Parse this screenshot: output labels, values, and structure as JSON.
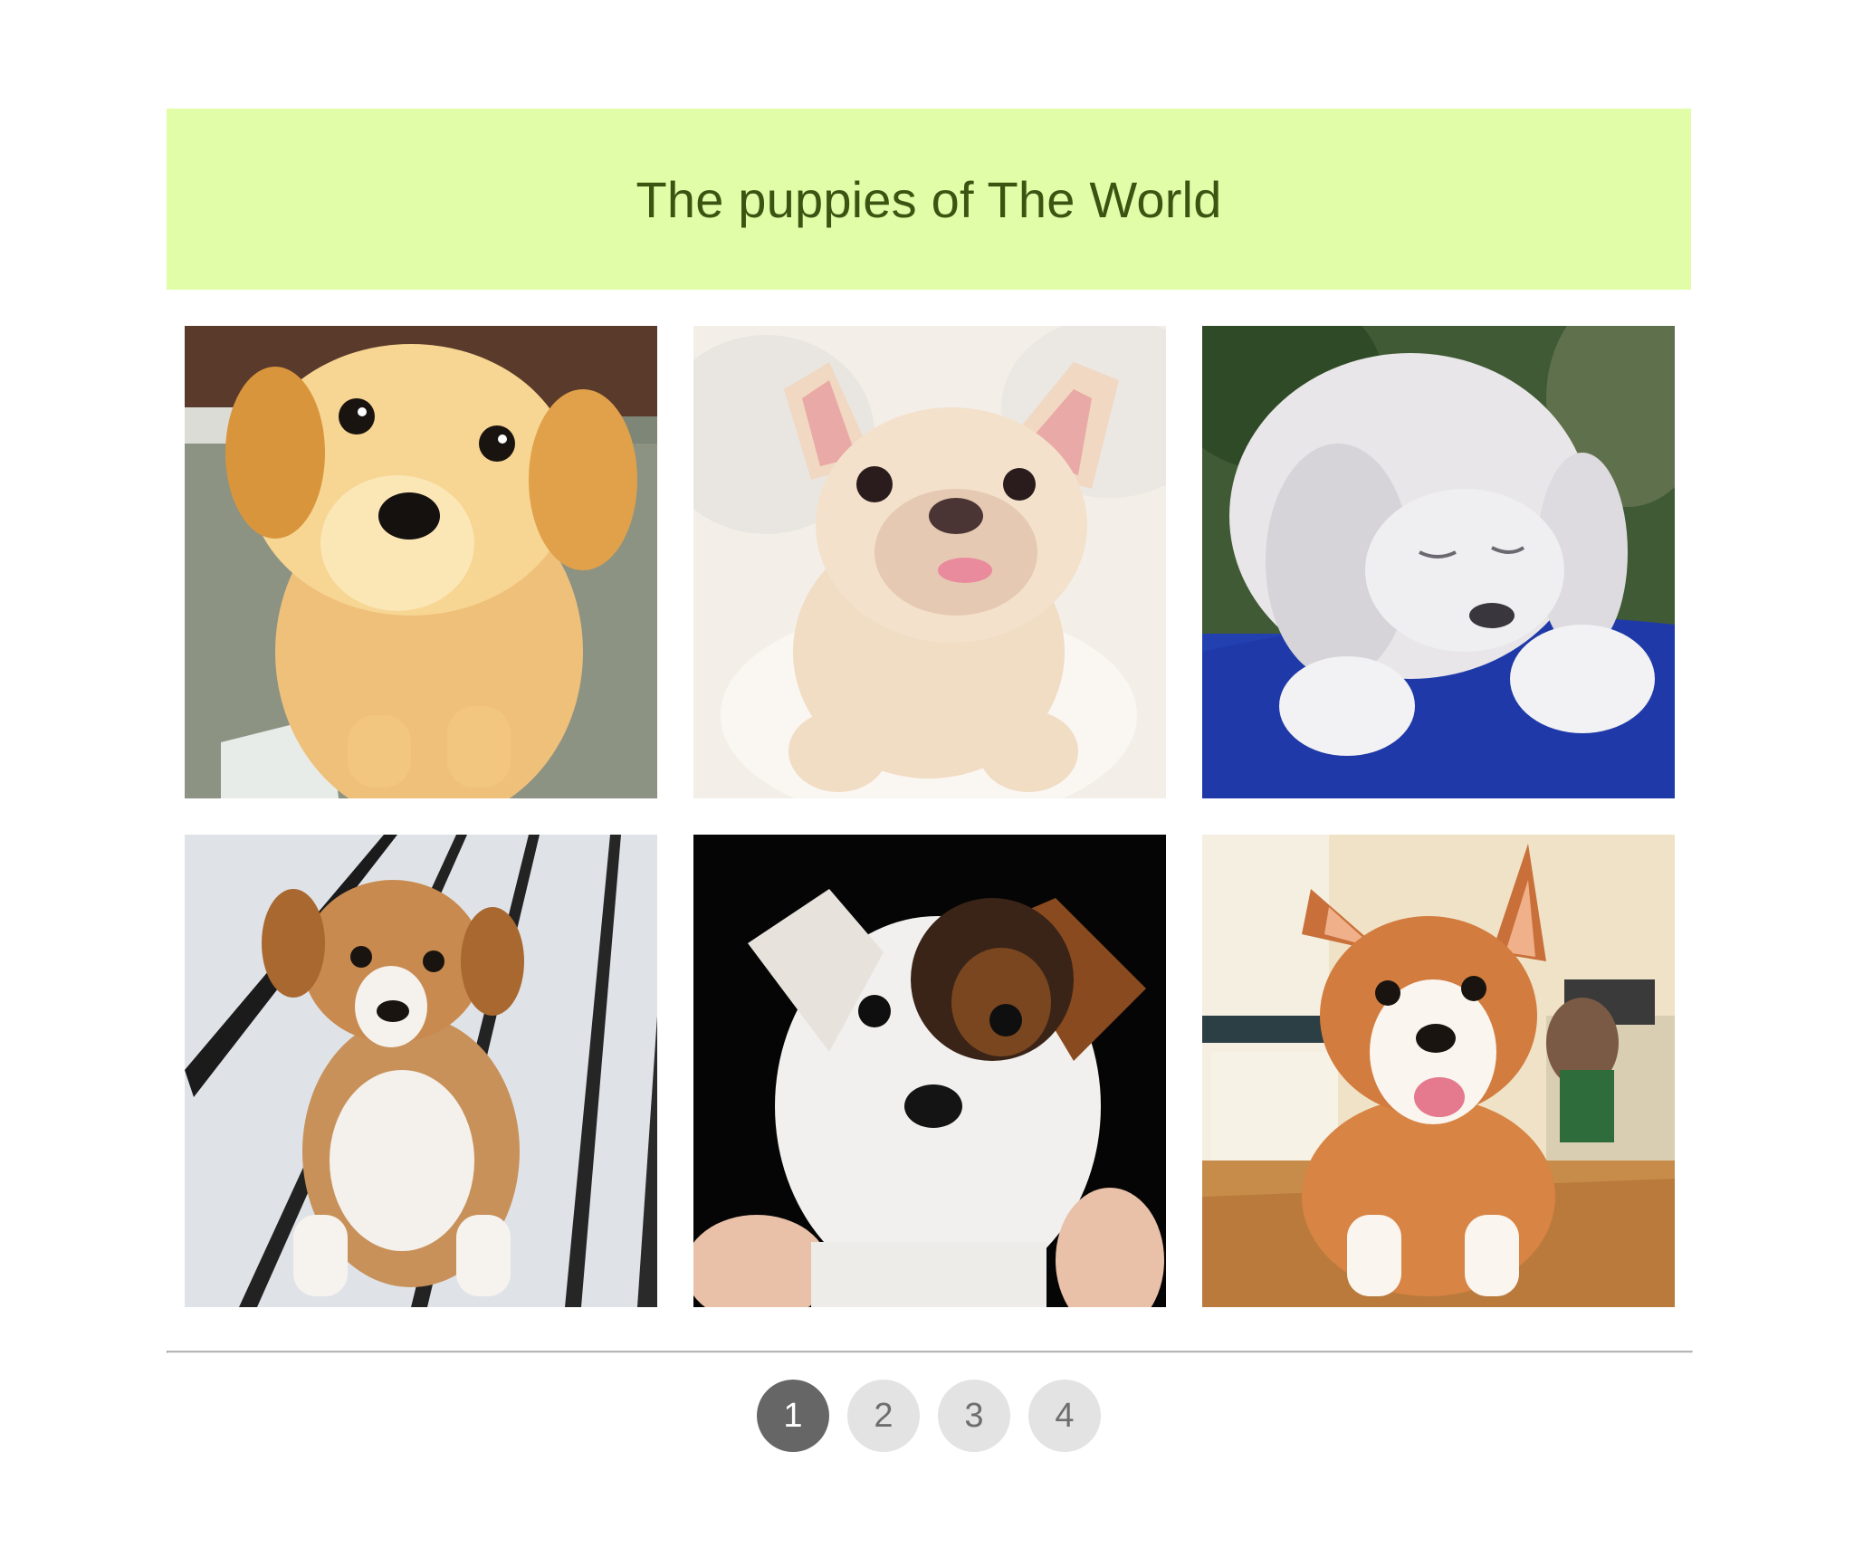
{
  "header": {
    "title": "The puppies of The World",
    "background": "#e2fda7",
    "title_color": "#3c5412"
  },
  "gallery": {
    "photos": [
      {
        "subject": "golden fluffy puppy on carpet"
      },
      {
        "subject": "cream french bulldog puppy on bed"
      },
      {
        "subject": "white fluffy puppy on blue blanket"
      },
      {
        "subject": "tan and white puppy on white deck"
      },
      {
        "subject": "white and brown jack russell puppy on black background"
      },
      {
        "subject": "corgi puppy in kitchen"
      }
    ]
  },
  "pagination": {
    "pages": [
      "1",
      "2",
      "3",
      "4"
    ],
    "current": "1",
    "active_color": "#666666",
    "inactive_color": "#e3e3e3"
  }
}
